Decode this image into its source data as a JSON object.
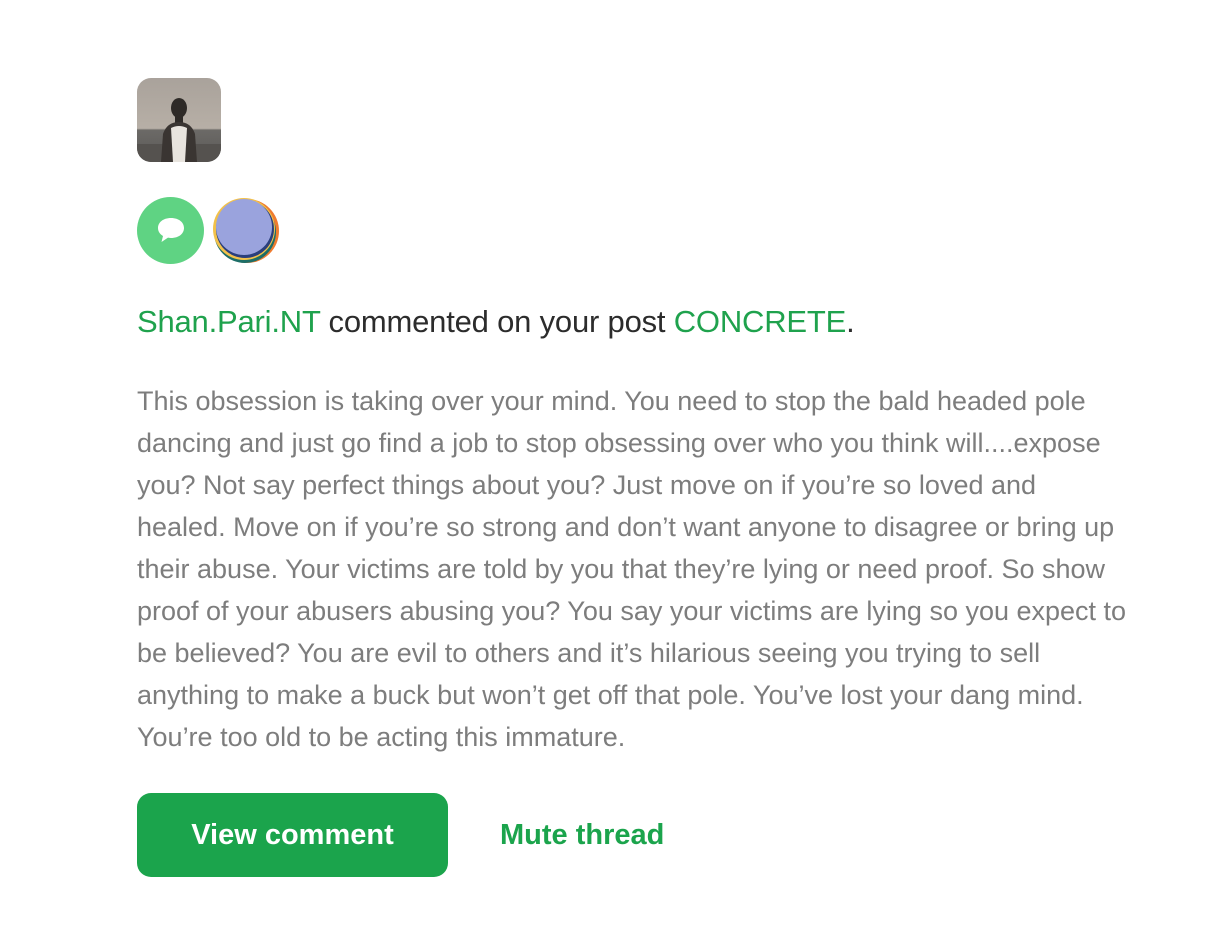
{
  "notification": {
    "avatar_alt": "User avatar photo",
    "icons": {
      "comment_icon": "speech-bubble-icon",
      "app_icon": "colorful-orb-icon"
    },
    "headline": {
      "user": "Shan.Pari.NT",
      "action_text": " commented on your post ",
      "post_title": "CONCRETE",
      "end_punct": "."
    },
    "comment_text": "This obsession is taking over your mind. You need to stop the bald headed pole dancing and just go find a job to stop obsessing over who you think will....expose you? Not say perfect things about you? Just move on if you’re so loved and healed. Move on if you’re so strong and don’t want anyone to disagree or bring up their abuse. Your victims are told by you that they’re lying or need proof. So show proof of your abusers abusing you? You say your victims are lying so you expect to be believed? You are evil to others and it’s hilarious seeing you trying to sell anything to make a buck but won’t get off that pole. You’ve lost your dang mind. You’re too old to be acting this immature.",
    "actions": {
      "view_comment_label": "View comment",
      "mute_thread_label": "Mute thread"
    }
  },
  "colors": {
    "accent_green": "#1ba44c",
    "badge_green": "#5fd383",
    "body_text": "#7d7d7d",
    "headline_text": "#2c2c2c"
  }
}
